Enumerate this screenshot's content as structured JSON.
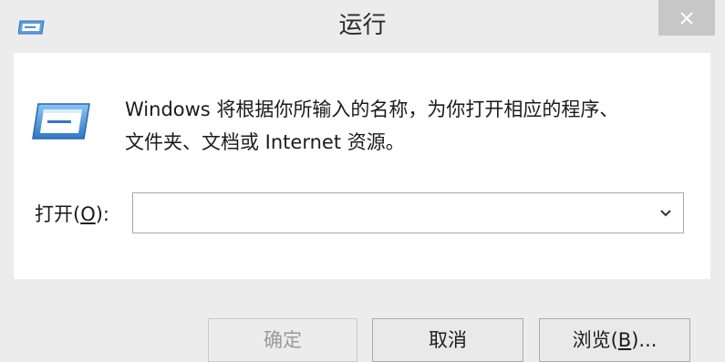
{
  "window": {
    "title": "运行",
    "close_icon": "close-icon",
    "app_icon": "run-icon"
  },
  "dialog": {
    "description_line1": "Windows 将根据你所输入的名称，为你打开相应的程序、",
    "description_line2": "文件夹、文档或 Internet 资源。",
    "open_label_prefix": "打开(",
    "open_label_mnemonic": "O",
    "open_label_suffix": "):",
    "input_value": ""
  },
  "buttons": {
    "ok_label": "确定",
    "cancel_label": "取消",
    "browse_prefix": "浏览(",
    "browse_mnemonic": "B",
    "browse_suffix": ")...",
    "ok_enabled": false
  },
  "colors": {
    "window_bg": "#ececec",
    "panel_bg": "#ffffff",
    "close_bg": "#c7c7c7",
    "disabled_text": "#9a9a9a",
    "icon_blue": "#3a7fd0"
  }
}
